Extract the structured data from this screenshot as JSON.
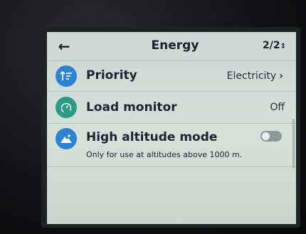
{
  "header": {
    "title": "Energy",
    "page_indicator": "2/2",
    "back_icon": "back-arrow-icon",
    "page_icon": "sort-arrows-icon"
  },
  "rows": [
    {
      "label": "Priority",
      "value": "Electricity",
      "icon": "priority-icon",
      "icon_color": "#2f82cf"
    },
    {
      "label": "Load monitor",
      "value": "Off",
      "icon": "gauge-icon",
      "icon_color": "#2e9a84"
    },
    {
      "label": "High altitude mode",
      "sublabel": "Only for use at altitudes above 1000 m.",
      "icon": "mountain-icon",
      "icon_color": "#2f82cf",
      "toggle_state": "off"
    }
  ]
}
